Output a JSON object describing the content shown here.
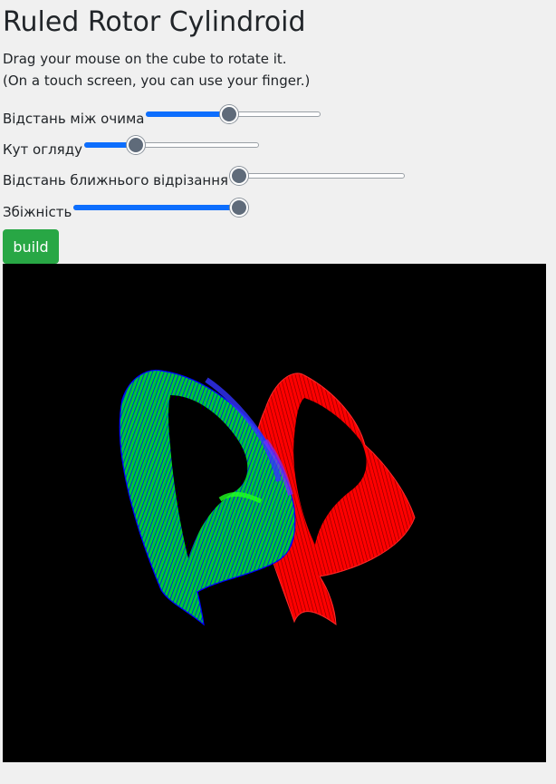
{
  "page": {
    "title": "Ruled Rotor Cylindroid",
    "instruction_line1": "Drag your mouse on the cube to rotate it.",
    "instruction_line2": "(On a touch screen, you can use your finger.)"
  },
  "controls": {
    "eye_distance": {
      "label": "Відстань між очима",
      "value_fraction": 0.47
    },
    "view_angle": {
      "label": "Кут огляду",
      "value_fraction": 0.27
    },
    "near_clip": {
      "label": "Відстань ближнього відрізання",
      "value_fraction": 0.0
    },
    "convergence": {
      "label": "Збіжність",
      "value_fraction": 1.0
    },
    "build_label": "build"
  },
  "scene": {
    "background": "#000000",
    "left_shape_colors": [
      "#0000ff",
      "#00ff00"
    ],
    "right_shape_color": "#ff0000"
  }
}
